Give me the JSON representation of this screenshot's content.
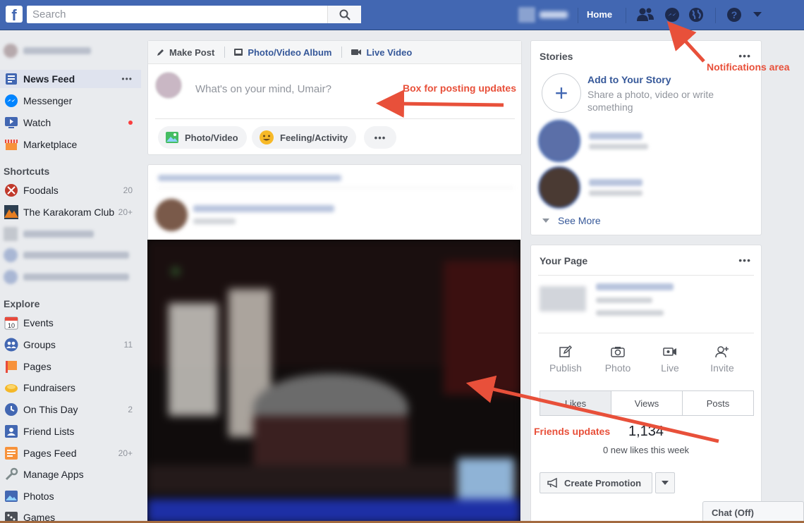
{
  "topbar": {
    "logo": "f",
    "search_placeholder": "Search",
    "home_label": "Home",
    "icons": [
      "search-icon",
      "friend-requests-icon",
      "messenger-icon",
      "notifications-globe-icon",
      "help-icon",
      "account-menu-caret-icon"
    ],
    "bar_color": "#4267b2"
  },
  "left_nav": {
    "main": [
      {
        "label": "News Feed",
        "icon": "news-feed-icon",
        "more": "•••"
      },
      {
        "label": "Messenger",
        "icon": "messenger-icon"
      },
      {
        "label": "Watch",
        "icon": "watch-icon",
        "badge_dot": true
      },
      {
        "label": "Marketplace",
        "icon": "marketplace-icon"
      }
    ],
    "shortcuts_heading": "Shortcuts",
    "shortcuts": [
      {
        "label": "Foodals",
        "count": "20"
      },
      {
        "label": "The Karakoram Club",
        "count": "20+"
      }
    ],
    "explore_heading": "Explore",
    "explore": [
      {
        "label": "Events",
        "count": "",
        "icon": "calendar-icon",
        "icon_text": "10"
      },
      {
        "label": "Groups",
        "count": "11",
        "icon": "groups-icon"
      },
      {
        "label": "Pages",
        "count": "",
        "icon": "pages-flag-icon"
      },
      {
        "label": "Fundraisers",
        "count": "",
        "icon": "fundraisers-icon"
      },
      {
        "label": "On This Day",
        "count": "2",
        "icon": "on-this-day-icon"
      },
      {
        "label": "Friend Lists",
        "count": "",
        "icon": "friend-lists-icon"
      },
      {
        "label": "Pages Feed",
        "count": "20+",
        "icon": "pages-feed-icon"
      },
      {
        "label": "Manage Apps",
        "count": "",
        "icon": "manage-apps-icon"
      },
      {
        "label": "Photos",
        "count": "",
        "icon": "photos-icon"
      },
      {
        "label": "Games",
        "count": "",
        "icon": "games-icon"
      }
    ]
  },
  "composer": {
    "tabs": [
      "Make Post",
      "Photo/Video Album",
      "Live Video"
    ],
    "placeholder": "What's on your mind, Umair?",
    "buttons": [
      "Photo/Video",
      "Feeling/Activity"
    ],
    "more": "•••"
  },
  "stories": {
    "title": "Stories",
    "more": "•••",
    "add_title": "Add to Your Story",
    "add_sub": "Share a photo, video or write something",
    "see_more": "See More"
  },
  "your_page": {
    "title": "Your Page",
    "more": "•••",
    "actions": [
      "Publish",
      "Photo",
      "Live",
      "Invite"
    ],
    "tabs": [
      "Likes",
      "Views",
      "Posts"
    ],
    "active_tab": "Likes",
    "likes_count": "1,134",
    "likes_sub": "0 new likes this week",
    "promo_label": "Create Promotion"
  },
  "chat": {
    "label": "Chat (Off)"
  },
  "annotations": {
    "notifications": "Notifications area",
    "composer": "Box for posting updates",
    "feed": "Friends updates",
    "color": "#e8503a"
  }
}
